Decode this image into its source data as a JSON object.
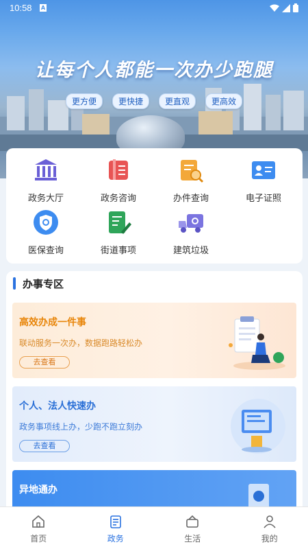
{
  "status": {
    "time": "10:58",
    "notif": "A"
  },
  "hero": {
    "slogan": "让每个人都能一次办少跑腿",
    "tags": [
      "更方便",
      "更快捷",
      "更直观",
      "更高效"
    ]
  },
  "services": [
    {
      "label": "政务大厅",
      "icon": "government-hall-icon",
      "color": "#6a5fd6"
    },
    {
      "label": "政务咨询",
      "icon": "consult-book-icon",
      "color": "#e85454"
    },
    {
      "label": "办件查询",
      "icon": "document-search-icon",
      "color": "#f3a83a"
    },
    {
      "label": "电子证照",
      "icon": "id-card-icon",
      "color": "#3d8cf0"
    },
    {
      "label": "医保查询",
      "icon": "medical-shield-icon",
      "color": "#3d8cf0"
    },
    {
      "label": "街道事项",
      "icon": "street-edit-icon",
      "color": "#2fa55a"
    },
    {
      "label": "建筑垃圾",
      "icon": "garbage-truck-icon",
      "color": "#7b74e0"
    }
  ],
  "zone": {
    "title": "办事专区",
    "cards": [
      {
        "title": "高效办成一件事",
        "desc": "联动服务一次办，数据跑路轻松办",
        "button": "去查看"
      },
      {
        "title": "个人、法人快速办",
        "desc": "政务事项线上办，少跑不跑立刻办",
        "button": "去查看"
      },
      {
        "title": "异地通办"
      }
    ]
  },
  "nav": [
    {
      "label": "首页",
      "icon": "home-icon"
    },
    {
      "label": "政务",
      "icon": "gov-affairs-icon"
    },
    {
      "label": "生活",
      "icon": "life-icon"
    },
    {
      "label": "我的",
      "icon": "profile-icon"
    }
  ]
}
